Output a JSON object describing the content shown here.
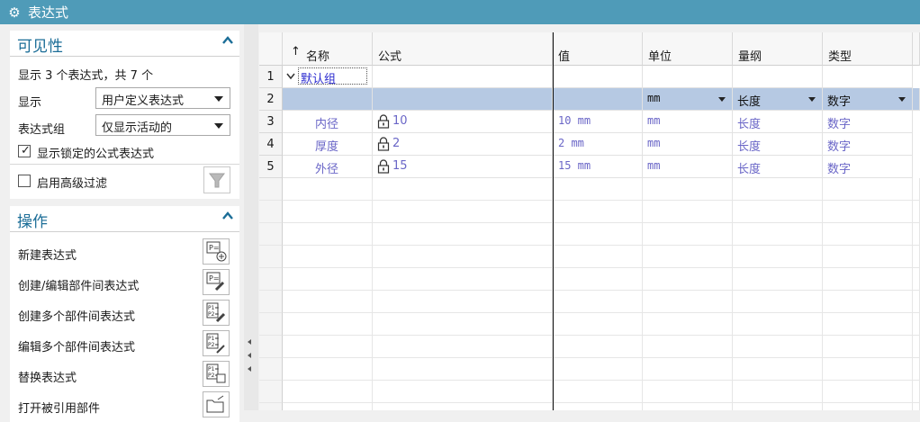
{
  "window": {
    "title": "表达式"
  },
  "visibility": {
    "heading": "可见性",
    "summary": "显示 3 个表达式，共 7 个",
    "display_label": "显示",
    "display_value": "用户定义表达式",
    "group_label": "表达式组",
    "group_value": "仅显示活动的",
    "show_locked": {
      "label": "显示锁定的公式表达式",
      "checked": true
    },
    "advanced_filter": {
      "label": "启用高级过滤",
      "checked": false
    }
  },
  "operations": {
    "heading": "操作",
    "items": [
      "新建表达式",
      "创建/编辑部件间表达式",
      "创建多个部件间表达式",
      "编辑多个部件间表达式",
      "替换表达式",
      "打开被引用部件"
    ]
  },
  "table": {
    "columns": [
      "↑",
      "名称",
      "公式",
      "值",
      "单位",
      "量纲",
      "类型"
    ],
    "group_name": "默认组",
    "new_row": {
      "unit": "mm",
      "dimension": "长度",
      "type": "数字"
    },
    "rows": [
      {
        "num": "3",
        "name": "内径",
        "formula": "10",
        "value": "10 mm",
        "unit": "mm",
        "dimension": "长度",
        "type": "数字"
      },
      {
        "num": "4",
        "name": "厚度",
        "formula": "2",
        "value": "2 mm",
        "unit": "mm",
        "dimension": "长度",
        "type": "数字"
      },
      {
        "num": "5",
        "name": "外径",
        "formula": "15",
        "value": "15 mm",
        "unit": "mm",
        "dimension": "长度",
        "type": "数字"
      }
    ],
    "row_numbers": [
      "1",
      "2"
    ]
  }
}
